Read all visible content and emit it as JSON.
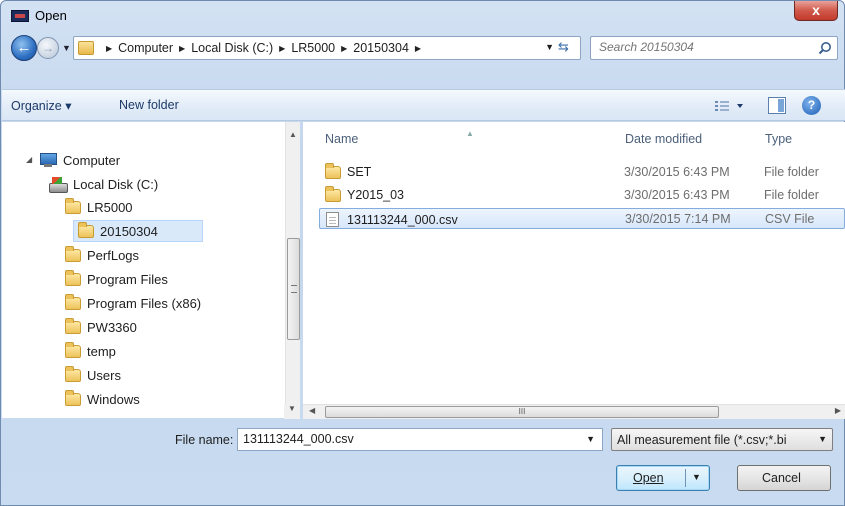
{
  "window": {
    "title": "Open",
    "close_label": "x"
  },
  "address": {
    "crumbs": [
      "Computer",
      "Local Disk (C:)",
      "LR5000",
      "20150304"
    ]
  },
  "search": {
    "placeholder": "Search 20150304"
  },
  "toolbar": {
    "organize_label": "Organize ▾",
    "new_folder_label": "New folder",
    "views_label": "▾",
    "help_label": "?"
  },
  "nav": {
    "computer": "Computer",
    "local_disk": "Local Disk (C:)",
    "folders": [
      "LR5000",
      "20150304",
      "PerfLogs",
      "Program Files",
      "Program Files (x86)",
      "PW3360",
      "temp",
      "Users",
      "Windows"
    ],
    "selected": "20150304"
  },
  "files": {
    "columns": {
      "name": "Name",
      "date": "Date modified",
      "type": "Type"
    },
    "rows": [
      {
        "name": "SET",
        "date": "3/30/2015 6:43 PM",
        "type": "File folder",
        "kind": "folder"
      },
      {
        "name": "Y2015_03",
        "date": "3/30/2015 6:43 PM",
        "type": "File folder",
        "kind": "folder"
      },
      {
        "name": "131113244_000.csv",
        "date": "3/30/2015 7:14 PM",
        "type": "CSV File",
        "kind": "file"
      }
    ],
    "selected_index": 2
  },
  "bottom": {
    "filename_label": "File name:",
    "filename_value": "131113244_000.csv",
    "filter_value": "All measurement file (*.csv;*.bi",
    "open_label": "Open",
    "cancel_label": "Cancel"
  },
  "scroll": {
    "hthumb_mark": "III",
    "vgrip": "≡"
  }
}
